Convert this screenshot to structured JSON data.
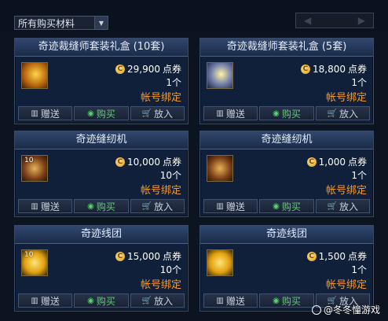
{
  "filter": {
    "label": "所有购买材料",
    "icon": "chevron-down-icon"
  },
  "pager": {
    "prev_icon": "◀",
    "next_icon": "▶"
  },
  "currency_icon": "C",
  "actions": {
    "gift": "赠送",
    "buy": "购买",
    "cart": "放入"
  },
  "items": [
    {
      "title": "奇迹裁缝师套装礼盒 (10套)",
      "price": "29,900",
      "unit": "点券",
      "count": "1个",
      "bind": "帐号绑定",
      "badge": "",
      "icon": "giftbox-icon"
    },
    {
      "title": "奇迹裁缝师套装礼盒 (5套)",
      "price": "18,800",
      "unit": "点券",
      "count": "1个",
      "bind": "帐号绑定",
      "badge": "",
      "icon": "giftbox-icon"
    },
    {
      "title": "奇迹缝纫机",
      "price": "10,000",
      "unit": "点券",
      "count": "10个",
      "bind": "帐号绑定",
      "badge": "10",
      "icon": "sewing-machine-icon"
    },
    {
      "title": "奇迹缝纫机",
      "price": "1,000",
      "unit": "点券",
      "count": "1个",
      "bind": "帐号绑定",
      "badge": "",
      "icon": "sewing-machine-icon"
    },
    {
      "title": "奇迹线团",
      "price": "15,000",
      "unit": "点券",
      "count": "10个",
      "bind": "帐号绑定",
      "badge": "10",
      "icon": "thread-ball-icon"
    },
    {
      "title": "奇迹线团",
      "price": "1,500",
      "unit": "点券",
      "count": "1个",
      "bind": "帐号绑定",
      "badge": "",
      "icon": "thread-ball-icon"
    }
  ],
  "watermark": "@冬冬憧游戏"
}
